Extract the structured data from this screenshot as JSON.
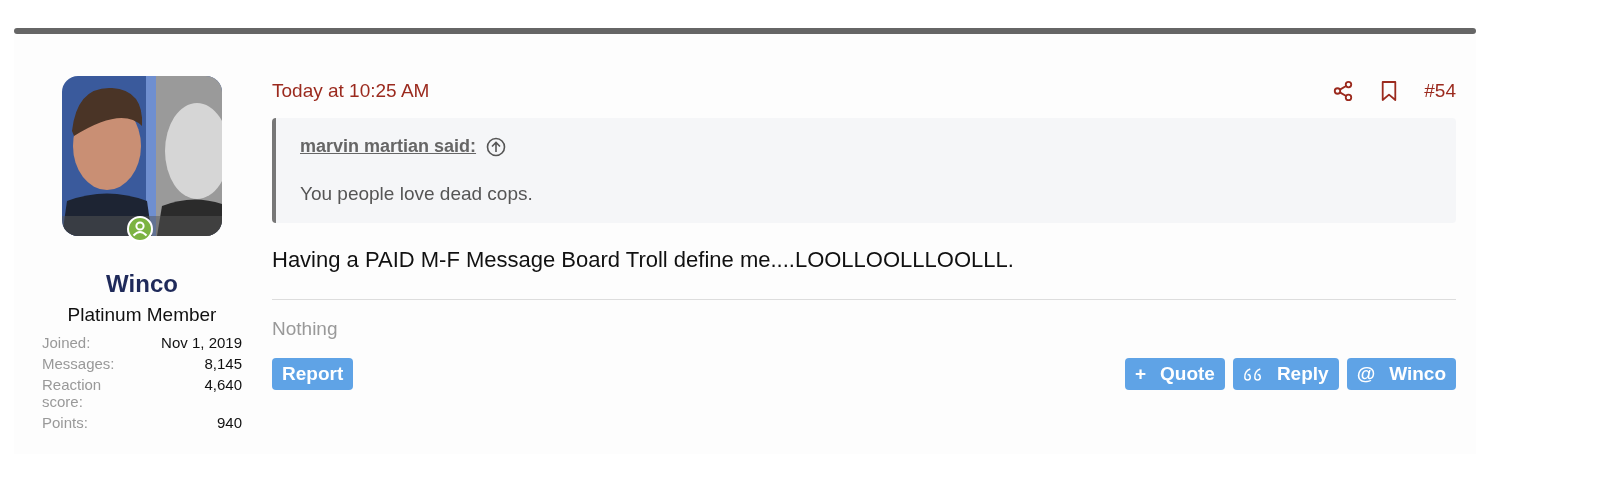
{
  "user": {
    "name": "Winco",
    "title": "Platinum Member",
    "online": true,
    "stats": [
      {
        "label": "Joined:",
        "value": "Nov 1, 2019"
      },
      {
        "label": "Messages:",
        "value": "8,145"
      },
      {
        "label": "Reaction score:",
        "value": "4,640"
      },
      {
        "label": "Points:",
        "value": "940"
      }
    ]
  },
  "post": {
    "time": "Today at 10:25 AM",
    "number": "#54",
    "quote": {
      "author": "marvin martian said:",
      "text": "You people love dead cops."
    },
    "body": "Having a PAID M-F Message Board Troll define me....LOOLLOOLLLOOLLL.",
    "reactions": "Nothing",
    "report": "Report",
    "actions": [
      {
        "kind": "quote",
        "glyph": "+",
        "label": "Quote"
      },
      {
        "kind": "reply",
        "label": "Reply"
      },
      {
        "kind": "mention",
        "glyph": "@",
        "label": "Winco"
      }
    ]
  }
}
